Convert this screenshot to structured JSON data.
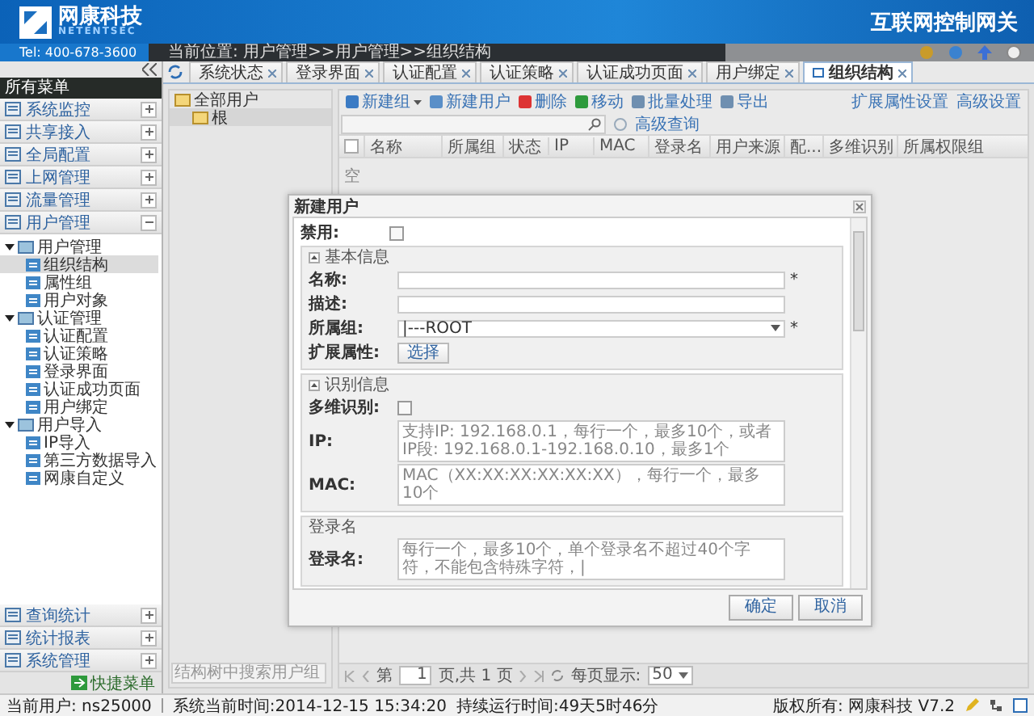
{
  "header": {
    "brand": "网康科技",
    "brand_en": "NETENTSEC",
    "phone": "Tel: 400-678-3600",
    "product": "互联网控制网关",
    "breadcrumb": "当前位置: 用户管理>>用户管理>>组织结构"
  },
  "tabs": [
    {
      "label": "系统状态",
      "selected": false
    },
    {
      "label": "登录界面",
      "selected": false
    },
    {
      "label": "认证配置",
      "selected": false
    },
    {
      "label": "认证策略",
      "selected": false
    },
    {
      "label": "认证成功页面",
      "selected": false
    },
    {
      "label": "用户绑定",
      "selected": false
    },
    {
      "label": "组织结构",
      "selected": true
    }
  ],
  "sidebar": {
    "title": "所有菜单",
    "quick_menu": "快捷菜单",
    "menus": [
      {
        "label": "系统监控",
        "expanded": false
      },
      {
        "label": "共享接入",
        "expanded": false
      },
      {
        "label": "全局配置",
        "expanded": false
      },
      {
        "label": "上网管理",
        "expanded": false
      },
      {
        "label": "流量管理",
        "expanded": false
      },
      {
        "label": "用户管理",
        "expanded": true,
        "children": [
          {
            "label": "用户管理",
            "expanded": true,
            "children": [
              {
                "label": "组织结构",
                "selected": true
              },
              {
                "label": "属性组",
                "selected": false
              },
              {
                "label": "用户对象",
                "selected": false
              }
            ]
          },
          {
            "label": "认证管理",
            "expanded": true,
            "children": [
              {
                "label": "认证配置",
                "selected": false
              },
              {
                "label": "认证策略",
                "selected": false
              },
              {
                "label": "登录界面",
                "selected": false
              },
              {
                "label": "认证成功页面",
                "selected": false
              },
              {
                "label": "用户绑定",
                "selected": false
              }
            ]
          },
          {
            "label": "用户导入",
            "expanded": true,
            "children": [
              {
                "label": "IP导入",
                "selected": false
              },
              {
                "label": "第三方数据导入",
                "selected": false
              },
              {
                "label": "网康自定义",
                "selected": false
              }
            ]
          }
        ]
      },
      {
        "label": "查询统计",
        "expanded": false
      },
      {
        "label": "统计报表",
        "expanded": false
      },
      {
        "label": "系统管理",
        "expanded": false
      }
    ]
  },
  "org_tree": {
    "root": "全部用户",
    "children": [
      {
        "label": "根",
        "selected": true
      }
    ],
    "search_placeholder": "结构树中搜索用户组"
  },
  "toolbar": {
    "buttons": [
      {
        "label": "新建组",
        "kind": "dropdown"
      },
      {
        "label": "新建用户",
        "kind": "plain"
      },
      {
        "label": "删除",
        "kind": "plain"
      },
      {
        "label": "移动",
        "kind": "plain"
      },
      {
        "label": "批量处理",
        "kind": "plain"
      },
      {
        "label": "导出",
        "kind": "plain"
      }
    ],
    "right": [
      "扩展属性设置",
      "高级设置"
    ],
    "advanced_search": "高级查询"
  },
  "table": {
    "select_all_checked": false,
    "columns": [
      "名称",
      "所属组",
      "状态",
      "IP",
      "MAC",
      "登录名",
      "用户来源",
      "配...",
      "多维识别",
      "所属权限组"
    ],
    "empty": "空"
  },
  "pager": {
    "page_label": "第",
    "page": "1",
    "page_suffix": "页,共 1 页",
    "per_page_label": "每页显示:",
    "per_page": "50"
  },
  "dialog": {
    "title": "新建用户",
    "disable": {
      "label": "禁用:",
      "checked": false
    },
    "basic": {
      "legend": "基本信息",
      "expanded": true,
      "fields": [
        {
          "kind": "text",
          "label": "名称:",
          "mark": "*"
        },
        {
          "kind": "text",
          "label": "描述:"
        },
        {
          "kind": "select",
          "label": "所属组:",
          "value": "|---ROOT",
          "mark": "*"
        },
        {
          "kind": "button",
          "label": "扩展属性:",
          "button": "选择"
        }
      ]
    },
    "ident": {
      "legend": "识别信息",
      "expanded": true,
      "fields": [
        {
          "kind": "checkbox",
          "label": "多维识别:",
          "checked": false
        },
        {
          "kind": "textarea",
          "label": "IP:",
          "placeholder": "支持IP: 192.168.0.1，每行一个，最多10个，或者IP段: 192.168.0.1-192.168.0.10，最多1个"
        },
        {
          "kind": "textarea",
          "label": "MAC:",
          "placeholder": "MAC（XX:XX:XX:XX:XX:XX），每行一个，最多10个"
        }
      ]
    },
    "login": {
      "legend": "登录名",
      "label": "登录名:",
      "placeholder": "每行一个，最多10个，单个登录名不超过40个字符，不能包含特殊字符，|"
    },
    "buttons": [
      "确定",
      "取消"
    ]
  },
  "status_bar": {
    "user": "当前用户: ns25000",
    "time": "系统当前时间:2014-12-15 15:34:20",
    "uptime": "持续运行时间:49天5时46分",
    "copyright": "版权所有: 网康科技 V7.2"
  }
}
